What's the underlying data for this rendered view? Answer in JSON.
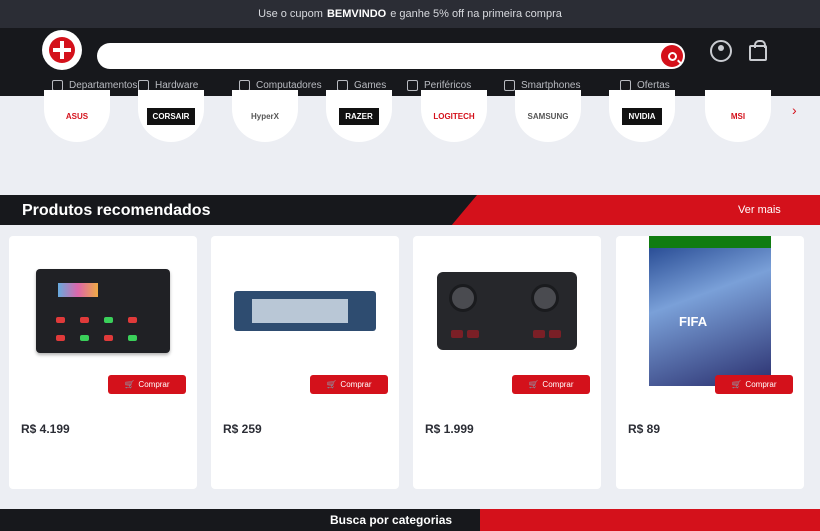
{
  "promo": {
    "prefix": "Use o cupom",
    "code": "BEMVINDO",
    "suffix": "e ganhe 5% off na primeira compra"
  },
  "header": {
    "search_hint": "",
    "search_placeholder": "",
    "nav_items": [
      "Departamentos",
      "Hardware",
      "Computadores",
      "Games",
      "Periféricos",
      "Smartphones",
      "Ofertas"
    ]
  },
  "brands": [
    {
      "label": "ASUS"
    },
    {
      "label": "CORSAIR"
    },
    {
      "label": "HyperX"
    },
    {
      "label": "RAZER"
    },
    {
      "label": "LOGITECH"
    },
    {
      "label": "SAMSUNG"
    },
    {
      "label": "NVIDIA"
    },
    {
      "label": "MSI"
    }
  ],
  "section": {
    "title": "Produtos recomendados",
    "see_more": "Ver mais"
  },
  "products": [
    {
      "badge": "Comprar",
      "price": "R$ 4.199",
      "installment": "",
      "name": ""
    },
    {
      "badge": "Comprar",
      "price": "R$ 259",
      "installment": "",
      "name": ""
    },
    {
      "badge": "Comprar",
      "price": "R$ 1.999",
      "installment": "",
      "name": ""
    },
    {
      "badge": "Comprar",
      "price": "R$ 89",
      "installment": "",
      "name": ""
    }
  ],
  "footer": {
    "title": "Busca por categorias"
  },
  "colors": {
    "accent": "#d4111b",
    "dark": "#17181c",
    "page_bg": "#eceef3"
  }
}
